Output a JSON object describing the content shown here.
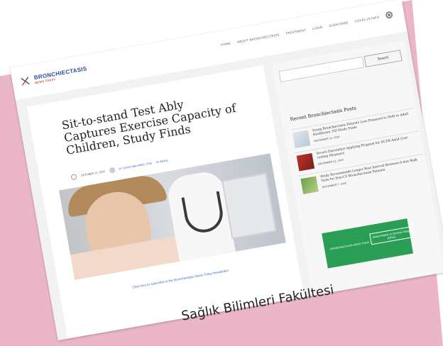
{
  "header": {
    "logo_line1": "BRONCHIECTASIS",
    "logo_line2": "NEWS TODAY",
    "nav": [
      "HOME",
      "ABOUT BRONCHIECTASIS",
      "TREATMENT",
      "LOGIN",
      "SUBSCRIBE",
      "COVID-19 INFO"
    ]
  },
  "article": {
    "title": "Sit-to-stand Test Ably Captures Exercise Capacity of Children, Study Finds",
    "date": "OCTOBER 14, 2020",
    "author": "BY DAVID MELAMED, PHD",
    "category": "IN NEWS",
    "subscribe_text": "Click here to subscribe to the Bronchiectasis News Today Newsletter!"
  },
  "sidebar": {
    "search_button": "Search",
    "recent_heading": "Recent Bronchiectasis Posts",
    "recent_posts": [
      {
        "title": "Young Bronchiectasis Patients Less Prepared to Shift to Adult Healthcare, NZ Study Finds",
        "date": "DECEMBER 14, 2020"
      },
      {
        "title": "Severe Discomfort Applying Program for NCFB Amid Cost-cutting Measures",
        "date": "DECEMBER 11, 2020"
      },
      {
        "title": "Study Recommends Longer Rest Interval Between 6-min Walk Tests for Non-CF Bronchiectasis Patients",
        "date": "DECEMBER 7, 2020"
      }
    ],
    "ad_logo": "BRONCHIECTASIS NEWS TODAY",
    "ad_text": "Brand Name or Generic Drug (DRG)"
  },
  "overlay": {
    "turkish_text": "Sağlık Bilimleri Fakültesi"
  },
  "colors": {
    "pink_background": "#eab6c8",
    "brand_blue": "#2b4d9c",
    "brand_red": "#d64a3a",
    "link_blue": "#3a6bc5",
    "ad_green": "#2a9e54"
  }
}
